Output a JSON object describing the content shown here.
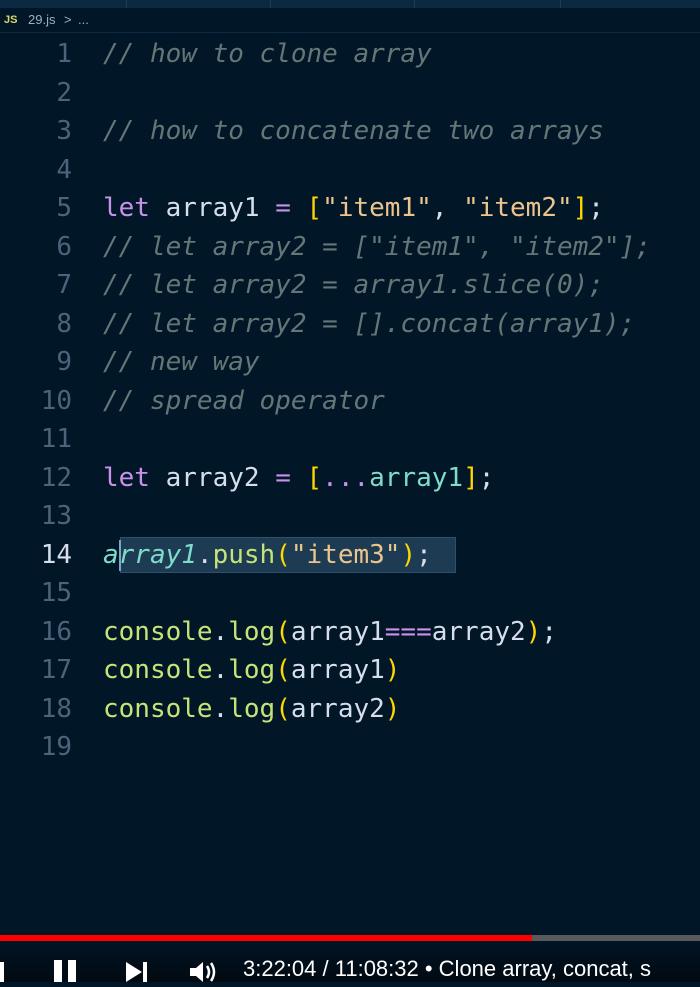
{
  "breadcrumb": {
    "lang_badge": "JS",
    "file_name": "29.js",
    "chevron": ">",
    "more": "..."
  },
  "editor": {
    "active_line": 14,
    "lines": [
      {
        "number": "1",
        "tokens": [
          {
            "t": "// how to clone array",
            "c": "comment"
          }
        ]
      },
      {
        "number": "2",
        "tokens": []
      },
      {
        "number": "3",
        "tokens": [
          {
            "t": "// how to concatenate two arrays",
            "c": "comment"
          }
        ]
      },
      {
        "number": "4",
        "tokens": []
      },
      {
        "number": "5",
        "tokens": [
          {
            "t": "let",
            "c": "kw"
          },
          {
            "t": " array1 ",
            "c": "var"
          },
          {
            "t": "=",
            "c": "op"
          },
          {
            "t": " ",
            "c": "var"
          },
          {
            "t": "[",
            "c": "bracket"
          },
          {
            "t": "\"item1\"",
            "c": "str"
          },
          {
            "t": ", ",
            "c": "punct"
          },
          {
            "t": "\"item2\"",
            "c": "str"
          },
          {
            "t": "]",
            "c": "bracket"
          },
          {
            "t": ";",
            "c": "punct"
          }
        ]
      },
      {
        "number": "6",
        "tokens": [
          {
            "t": "// let array2 = [\"item1\", \"item2\"];",
            "c": "comment"
          }
        ]
      },
      {
        "number": "7",
        "tokens": [
          {
            "t": "// let array2 = array1.slice(0);",
            "c": "comment"
          }
        ]
      },
      {
        "number": "8",
        "tokens": [
          {
            "t": "// let array2 = [].concat(array1);",
            "c": "comment"
          }
        ]
      },
      {
        "number": "9",
        "tokens": [
          {
            "t": "// new way",
            "c": "comment"
          }
        ]
      },
      {
        "number": "10",
        "tokens": [
          {
            "t": "// spread operator",
            "c": "comment"
          }
        ]
      },
      {
        "number": "11",
        "tokens": []
      },
      {
        "number": "12",
        "tokens": [
          {
            "t": "let",
            "c": "kw"
          },
          {
            "t": " array2 ",
            "c": "var"
          },
          {
            "t": "=",
            "c": "op"
          },
          {
            "t": " ",
            "c": "var"
          },
          {
            "t": "[",
            "c": "bracket"
          },
          {
            "t": "...",
            "c": "spread"
          },
          {
            "t": "array1",
            "c": "prop"
          },
          {
            "t": "]",
            "c": "bracket"
          },
          {
            "t": ";",
            "c": "punct"
          }
        ]
      },
      {
        "number": "13",
        "tokens": []
      },
      {
        "number": "14",
        "tokens": [
          {
            "t": "array1",
            "c": "italicvar"
          },
          {
            "t": ".",
            "c": "dot"
          },
          {
            "t": "push",
            "c": "meth"
          },
          {
            "t": "(",
            "c": "paren"
          },
          {
            "t": "\"item3\"",
            "c": "str"
          },
          {
            "t": ")",
            "c": "paren"
          },
          {
            "t": ";",
            "c": "punct"
          }
        ]
      },
      {
        "number": "15",
        "tokens": []
      },
      {
        "number": "16",
        "tokens": [
          {
            "t": "console",
            "c": "obj"
          },
          {
            "t": ".",
            "c": "dot"
          },
          {
            "t": "log",
            "c": "meth"
          },
          {
            "t": "(",
            "c": "paren"
          },
          {
            "t": "array1",
            "c": "var"
          },
          {
            "t": "===",
            "c": "op"
          },
          {
            "t": "array2",
            "c": "var"
          },
          {
            "t": ")",
            "c": "paren"
          },
          {
            "t": ";",
            "c": "punct"
          }
        ]
      },
      {
        "number": "17",
        "tokens": [
          {
            "t": "console",
            "c": "obj"
          },
          {
            "t": ".",
            "c": "dot"
          },
          {
            "t": "log",
            "c": "meth"
          },
          {
            "t": "(",
            "c": "paren"
          },
          {
            "t": "array1",
            "c": "var"
          },
          {
            "t": ")",
            "c": "paren"
          }
        ]
      },
      {
        "number": "18",
        "tokens": [
          {
            "t": "console",
            "c": "obj"
          },
          {
            "t": ".",
            "c": "dot"
          },
          {
            "t": "log",
            "c": "meth"
          },
          {
            "t": "(",
            "c": "paren"
          },
          {
            "t": "array2",
            "c": "var"
          },
          {
            "t": ")",
            "c": "paren"
          }
        ]
      },
      {
        "number": "19",
        "tokens": []
      }
    ]
  },
  "video": {
    "progress": 0.76,
    "time_text": "3:22:04 / 11:08:32 • Clone array, concat, s",
    "icons": [
      "prev-icon",
      "pause-icon",
      "next-icon",
      "volume-icon"
    ],
    "colors": {
      "played": "#ff0000",
      "track": "#5a5a5a"
    }
  }
}
